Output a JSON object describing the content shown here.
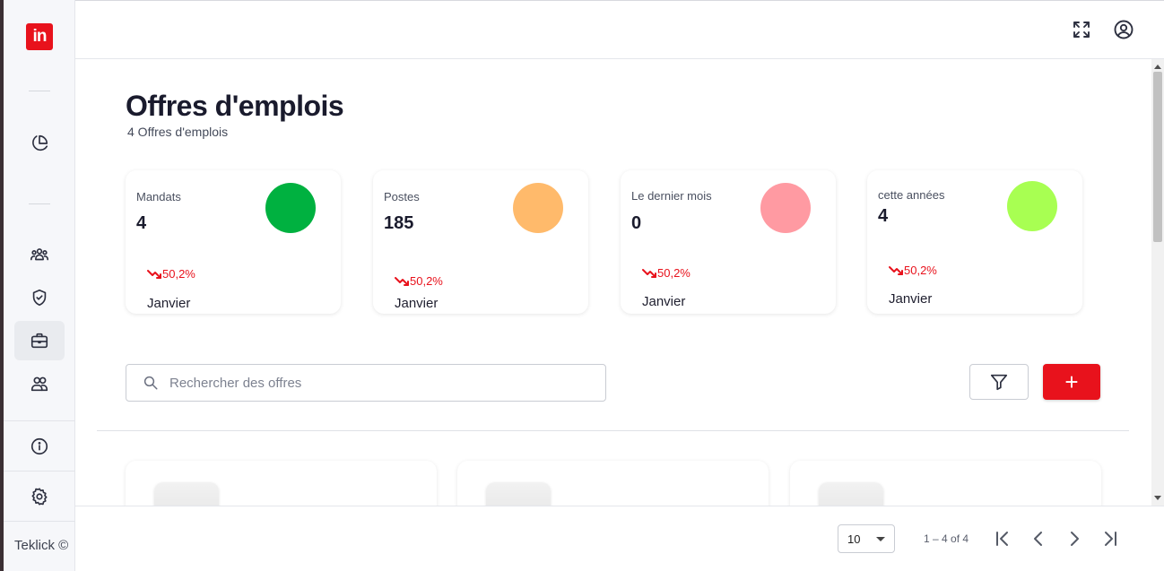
{
  "sidebar": {
    "logo_text": "in",
    "brand": "Teklick ©",
    "items": [
      {
        "name": "dashboard",
        "icon": "pie-chart-icon"
      },
      {
        "name": "team",
        "icon": "users-group-icon"
      },
      {
        "name": "security",
        "icon": "shield-check-icon"
      },
      {
        "name": "jobs",
        "icon": "briefcase-icon",
        "active": true
      },
      {
        "name": "people",
        "icon": "two-users-icon"
      },
      {
        "name": "info",
        "icon": "info-icon"
      },
      {
        "name": "settings",
        "icon": "gear-icon"
      }
    ]
  },
  "topbar": {
    "fullscreen_icon": "fullscreen-icon",
    "account_icon": "account-circle-icon"
  },
  "page": {
    "title": "Offres d'emplois",
    "subtitle": "4 Offres d'emplois"
  },
  "stats": [
    {
      "label": "Mandats",
      "value": "4",
      "color": "#00b140",
      "trend": "50,2%",
      "month": "Janvier"
    },
    {
      "label": "Postes",
      "value": "185",
      "color": "#ffba6b",
      "trend": "50,2%",
      "month": "Janvier"
    },
    {
      "label": "Le dernier mois",
      "value": "0",
      "color": "#ff9aa2",
      "trend": "50,2%",
      "month": "Janvier"
    },
    {
      "label": "cette années",
      "value": "4",
      "color": "#a8ff52",
      "trend": "50,2%",
      "month": "Janvier"
    }
  ],
  "search": {
    "placeholder": "Rechercher des offres",
    "value": ""
  },
  "actions": {
    "add_label": "+"
  },
  "paginator": {
    "page_size": "10",
    "range": "1 – 4 of 4"
  },
  "colors": {
    "accent": "#e8121c"
  }
}
